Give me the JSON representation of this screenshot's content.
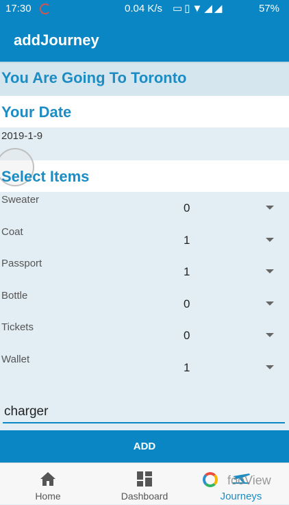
{
  "status_bar": {
    "time": "17:30",
    "network_speed": "0.04 K/s",
    "battery": "57%"
  },
  "app_bar": {
    "title": "addJourney"
  },
  "destination": {
    "heading": "You Are Going To Toronto"
  },
  "date_section": {
    "heading": "Your Date",
    "value": "2019-1-9"
  },
  "items_section": {
    "heading": "Select Items",
    "items": [
      {
        "label": "Sweater",
        "quantity": "0"
      },
      {
        "label": "Coat",
        "quantity": "1"
      },
      {
        "label": "Passport",
        "quantity": "1"
      },
      {
        "label": "Bottle",
        "quantity": "0"
      },
      {
        "label": "Tickets",
        "quantity": "0"
      },
      {
        "label": "Wallet",
        "quantity": "1"
      }
    ]
  },
  "new_item_input": {
    "value": "charger"
  },
  "add_button": {
    "label": "ADD"
  },
  "bottom_nav": {
    "items": [
      {
        "label": "Home",
        "icon": "home-icon"
      },
      {
        "label": "Dashboard",
        "icon": "dashboard-icon"
      },
      {
        "label": "Journeys",
        "icon": "plane-icon",
        "active": true
      }
    ]
  },
  "watermark": {
    "text": "fooView"
  },
  "colors": {
    "primary": "#0a86c4",
    "accent_text": "#1d8cc2",
    "background": "#e2eef3"
  }
}
